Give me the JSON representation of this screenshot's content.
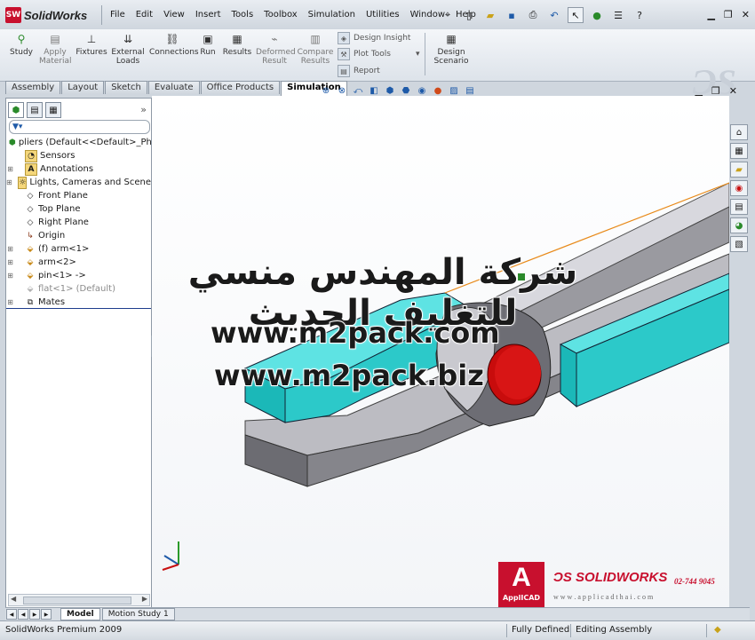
{
  "app": {
    "logo_text": "SW",
    "name": "SolidWorks"
  },
  "menu": [
    "File",
    "Edit",
    "View",
    "Insert",
    "Tools",
    "Toolbox",
    "Simulation",
    "Utilities",
    "Window",
    "Help"
  ],
  "command_manager": {
    "study": "Study",
    "apply_material": "Apply\nMaterial",
    "fixtures": "Fixtures",
    "external_loads": "External\nLoads",
    "connections": "Connections",
    "run": "Run",
    "results": "Results",
    "deformed_result": "Deformed\nResult",
    "compare_results": "Compare\nResults",
    "design_insight": "Design Insight",
    "plot_tools": "Plot Tools",
    "report": "Report",
    "design_scenario": "Design\nScenario"
  },
  "tabs": [
    "Assembly",
    "Layout",
    "Sketch",
    "Evaluate",
    "Office Products",
    "Simulation"
  ],
  "active_tab": "Simulation",
  "feature_tree": {
    "root": "pliers  (Default<<Default>_Phot",
    "items": [
      {
        "label": "Sensors",
        "icon": "sensor-icon",
        "expandable": false
      },
      {
        "label": "Annotations",
        "icon": "annotation-icon",
        "expandable": true
      },
      {
        "label": "Lights, Cameras and Scene",
        "icon": "lights-icon",
        "expandable": true
      },
      {
        "label": "Front Plane",
        "icon": "plane-icon",
        "expandable": false
      },
      {
        "label": "Top Plane",
        "icon": "plane-icon",
        "expandable": false
      },
      {
        "label": "Right Plane",
        "icon": "plane-icon",
        "expandable": false
      },
      {
        "label": "Origin",
        "icon": "origin-icon",
        "expandable": false
      },
      {
        "label": "(f) arm<1>",
        "icon": "part-icon",
        "expandable": true
      },
      {
        "label": "arm<2>",
        "icon": "part-icon",
        "expandable": true
      },
      {
        "label": "pin<1> ->",
        "icon": "part-icon",
        "expandable": true
      },
      {
        "label": "flat<1> (Default)",
        "icon": "part-icon",
        "expandable": false,
        "muted": true
      },
      {
        "label": "Mates",
        "icon": "mates-icon",
        "expandable": true
      }
    ]
  },
  "bottom_tabs": [
    "Model",
    "Motion Study 1"
  ],
  "status": {
    "left": "SolidWorks Premium 2009",
    "defined": "Fully Defined",
    "mode": "Editing Assembly"
  },
  "watermark": {
    "arabic": "شركة المهندس منسي للتغليف الحديث",
    "url1": "www.m2pack.com",
    "url2": "www.m2pack.biz"
  },
  "applicad": {
    "brand": "ApplICAD",
    "solidworks": "SOLIDWORKS",
    "phone": "02-744 9045",
    "website": "w w w . a p p l i c a d t h a i . c o m"
  },
  "colors": {
    "cyan_part": "#33d6d6",
    "gray_part": "#8a8a90",
    "pin": "#d40f0f",
    "accent_red": "#c8102e"
  }
}
